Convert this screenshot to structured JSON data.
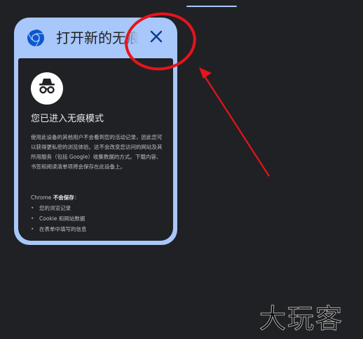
{
  "tab": {
    "title": "打开新的无痕标签页",
    "close_icon": "close-icon",
    "browser_icon": "chrome-icon"
  },
  "incognito": {
    "avatar_icon": "incognito-icon",
    "heading": "您已进入无痕模式",
    "description": "使用此设备的其他用户不会看到您的活动记录，因此您可以获得更私密的浏览体验。这不会改变您访问的网站及其所用服务（包括 Google）收集数据的方式。下载内容、书签和阅读清单项将会保存在此设备上。",
    "not_saved_prefix": "Chrome ",
    "not_saved_bold": "不会保存",
    "not_saved_suffix": "：",
    "not_saved_items": [
      "您的浏览记录",
      "Cookie 和网站数据",
      "在表单中填写的信息"
    ]
  },
  "watermark": "大玩客",
  "colors": {
    "background": "#202124",
    "tab_accent": "#a8c7fa",
    "annotation_red": "#e8131b"
  }
}
